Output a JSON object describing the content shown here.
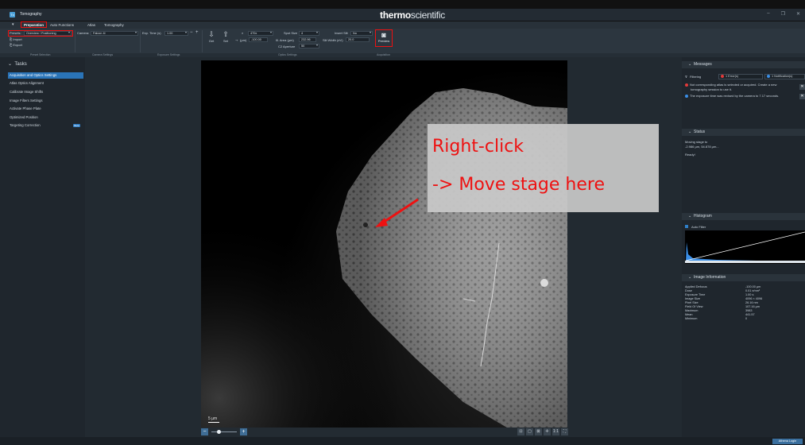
{
  "window": {
    "app_icon_letter": "Tx",
    "app_title": "Tomography",
    "brand_bold": "thermo",
    "brand_thin": "scientific",
    "controls": [
      "–",
      "❐",
      "✕"
    ]
  },
  "ribbon": {
    "tabs": [
      "Preparation",
      "Auto Functions",
      "Atlas",
      "Tomography"
    ],
    "presets_label": "Presets:",
    "presets_value": "Overview / Positioning",
    "import_label": "Import",
    "export_label": "Export",
    "camera_label": "Camera:",
    "camera_value": "Falcon 4i",
    "exp_time_label": "Exp. Time (s)",
    "exp_time_value": "1.00",
    "get_label": "Get",
    "set_label": "Set",
    "magnification_value": "470x",
    "defocus_label": "(µm)",
    "defocus_value": "-100.00",
    "spot_size_label": "Spot Size",
    "spot_size_value": "4",
    "ill_area_label": "Ill. Area (µm)",
    "ill_area_value": "232.96",
    "c2_aperture_label": "C2 Aperture",
    "c2_aperture_value": "50",
    "insert_slit_label": "Insert Slit",
    "insert_slit_value": "No",
    "slit_width_label": "Slit Width (eV)",
    "slit_width_value": "20.0",
    "preview_label": "Preview",
    "group_labels": [
      "Preset Selection",
      "Camera Settings",
      "Exposure Settings",
      "Optics Settings",
      "Acquisition"
    ]
  },
  "tasks": {
    "header": "Tasks",
    "items": [
      {
        "label": "Acquisition and Optics Settings",
        "active": true
      },
      {
        "label": "Atlas Optics Alignment"
      },
      {
        "label": "Calibrate Image Shifts"
      },
      {
        "label": "Image Filters Settings"
      },
      {
        "label": "Activate Phase Plate"
      },
      {
        "label": "Optimized Position"
      },
      {
        "label": "Targeting Correction",
        "badge": "Beta"
      }
    ]
  },
  "viewer": {
    "scalebar_label": "5 µm",
    "tools": [
      "⊡",
      "▢",
      "⊠",
      "✛",
      "1:1",
      "⛶"
    ]
  },
  "annotation": {
    "line1": "Right-click",
    "line2": "-> Move stage here",
    "color": "#ee1111"
  },
  "messages": {
    "header": "Messages",
    "filtering_label": "Filtering",
    "errors_pill": "1 Error(s)",
    "notifications_pill": "1 Notification(s)",
    "items": [
      {
        "type": "error",
        "text_line1": "Not corresponding atlas is selected or acquired. Create a new",
        "text_line2": "tomography session to use it."
      },
      {
        "type": "info",
        "text_line1": "The exposure time was revised by the camera to 7.17 seconds.",
        "text_line2": ""
      }
    ]
  },
  "status": {
    "header": "Status",
    "lines": [
      "Moving stage to",
      "-2.986 µm, 54.878 µm...",
      "Ready!"
    ]
  },
  "histogram": {
    "header": "Histogram",
    "auto_filter_label": "Auto Filter"
  },
  "image_information": {
    "header": "Image Information",
    "rows": [
      {
        "key": "Applied Defocus",
        "value": "-100.00 µm"
      },
      {
        "key": "Dose",
        "value": "0.01 e/nm²"
      },
      {
        "key": "Exposure Time",
        "value": "1.00 s"
      },
      {
        "key": "Image Size",
        "value": "4096 × 4096"
      },
      {
        "key": "Pixel Size",
        "value": "26.16 nm"
      },
      {
        "key": "Field Of View",
        "value": "107.16 µm"
      },
      {
        "key": "Maximum",
        "value": "3983"
      },
      {
        "key": "Mean",
        "value": "441.57"
      },
      {
        "key": "Minimum",
        "value": "0"
      }
    ]
  },
  "statusbar": {
    "athena_login": "Athena Login"
  },
  "colors": {
    "accent_blue": "#2a74b8",
    "highlight_red": "#ee1111",
    "error_red": "#e23a3a",
    "info_blue": "#3a8ee6"
  }
}
